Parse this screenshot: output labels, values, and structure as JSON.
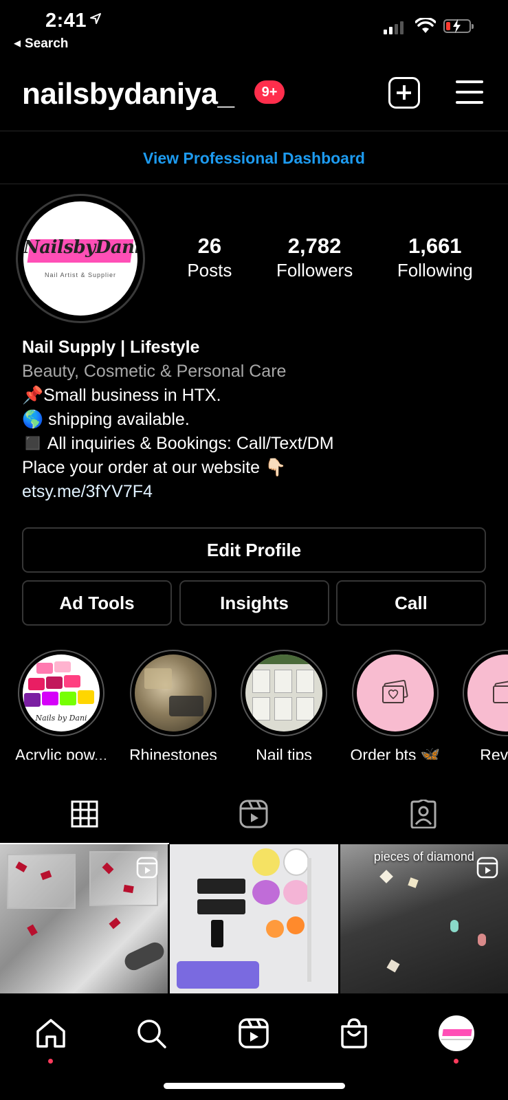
{
  "status_bar": {
    "time": "2:41",
    "back_label": "Search"
  },
  "header": {
    "username": "nailsbydaniya_",
    "notification_count": "9+"
  },
  "professional_dashboard": "View Professional Dashboard",
  "profile": {
    "avatar_logo": "NailsbyDaniya",
    "avatar_subtitle": "Nail Artist & Supplier",
    "stats": [
      {
        "value": "26",
        "label": "Posts"
      },
      {
        "value": "2,782",
        "label": "Followers"
      },
      {
        "value": "1,661",
        "label": "Following"
      }
    ],
    "bio": {
      "name": "Nail Supply | Lifestyle",
      "category": "Beauty, Cosmetic & Personal Care",
      "lines": [
        "📌Small business in HTX.",
        "🌎 shipping available.",
        "◼️ All inquiries & Bookings: Call/Text/DM",
        "Place your order at our website 👇🏻"
      ],
      "link": "etsy.me/3fYV7F4"
    }
  },
  "buttons": {
    "edit_profile": "Edit Profile",
    "ad_tools": "Ad Tools",
    "insights": "Insights",
    "call": "Call"
  },
  "highlights": [
    {
      "label": "Acrylic pow...",
      "watermark": "Nails by Dani"
    },
    {
      "label": "Rhinestones"
    },
    {
      "label": "Nail tips"
    },
    {
      "label": "Order bts 🦋"
    },
    {
      "label": "Review"
    }
  ],
  "grid_posts": [
    {
      "overlay": ""
    },
    {
      "overlay": ""
    },
    {
      "overlay": "pieces of diamond"
    }
  ],
  "colors": {
    "background": "#000000",
    "link_blue": "#1d9bf0",
    "badge_red": "#ff2e4c",
    "border": "#363636"
  }
}
